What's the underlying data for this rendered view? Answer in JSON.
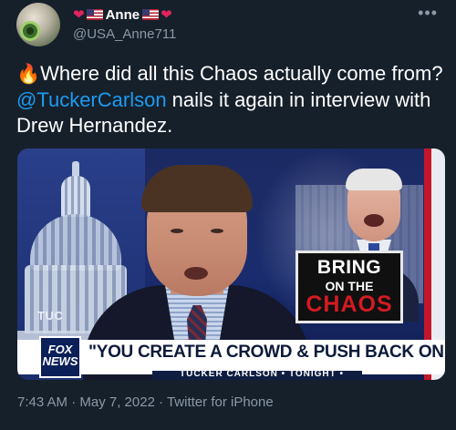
{
  "author": {
    "name": "Anne",
    "handle": "@USA_Anne711",
    "name_decorations": [
      "heart-icon",
      "us-flag-icon",
      "us-flag-icon",
      "heart-icon"
    ]
  },
  "more_icon": "•••",
  "tweet": {
    "emoji": "🔥",
    "text_before": "Where did all this Chaos actually come from? ",
    "mention": "@TuckerCarlson",
    "text_after": " nails it again in interview with Drew Hernandez."
  },
  "media": {
    "background_label": "TUC",
    "graphic": {
      "line1": "BRING",
      "line2": "ON THE",
      "line3": "CHAOS"
    },
    "chyron": "\"YOU CREATE A CROWD & PUSH BACK ON THEM\"",
    "chyron_sub": "TUCKER CARLSON • TONIGHT •",
    "logo": {
      "line1": "FOX",
      "line2": "NEWS"
    }
  },
  "timestamp": "7:43 AM · May 7, 2022 · Twitter for iPhone",
  "colors": {
    "background": "#15202b",
    "mention": "#1d9bf0",
    "secondary_text": "#8b98a5",
    "heart": "#e0245e",
    "chaos_red": "#d31b22"
  }
}
